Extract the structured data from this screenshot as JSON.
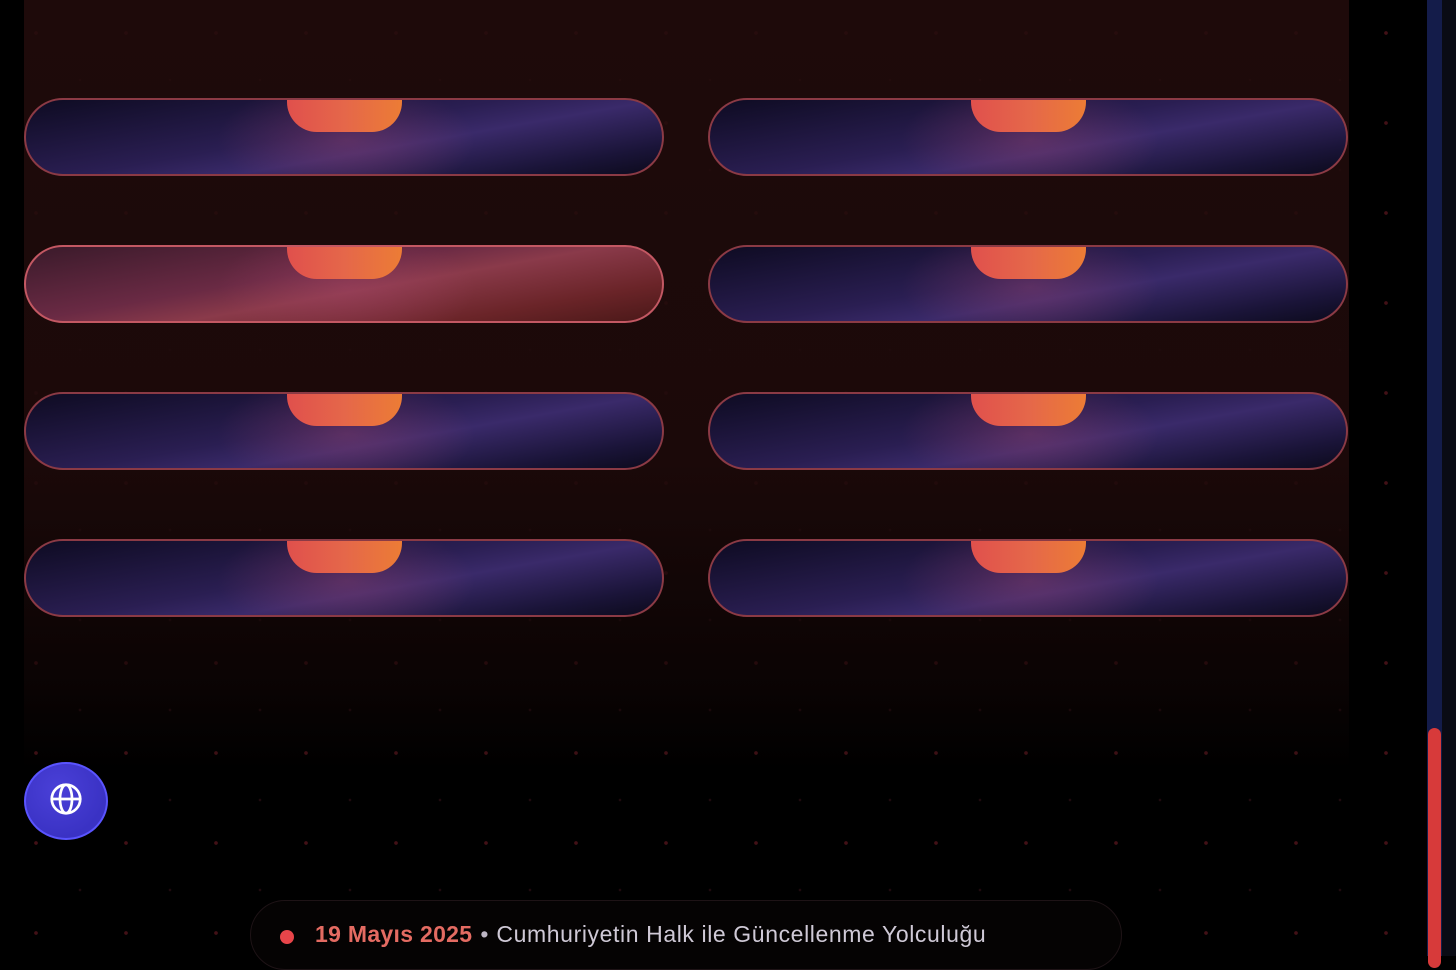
{
  "footer": {
    "date": "19 Mayıs 2025",
    "separator": "•",
    "title": "Cumhuriyetin Halk ile Güncellenme Yolculuğu"
  },
  "cards": [
    {
      "column": "left",
      "row": 1,
      "active": false
    },
    {
      "column": "right",
      "row": 1,
      "active": false
    },
    {
      "column": "left",
      "row": 2,
      "active": true
    },
    {
      "column": "right",
      "row": 2,
      "active": false
    },
    {
      "column": "left",
      "row": 3,
      "active": false
    },
    {
      "column": "right",
      "row": 3,
      "active": false
    },
    {
      "column": "left",
      "row": 4,
      "active": false
    },
    {
      "column": "right",
      "row": 4,
      "active": false
    }
  ],
  "language_button": {
    "icon": "globe-icon"
  },
  "scrollbar": {
    "position_fraction": 0.76
  },
  "colors": {
    "accent": "#e8454a",
    "fab": "#3a32c4",
    "card_border": "#8b3a45",
    "scrollbar_thumb": "#d73a3a"
  }
}
